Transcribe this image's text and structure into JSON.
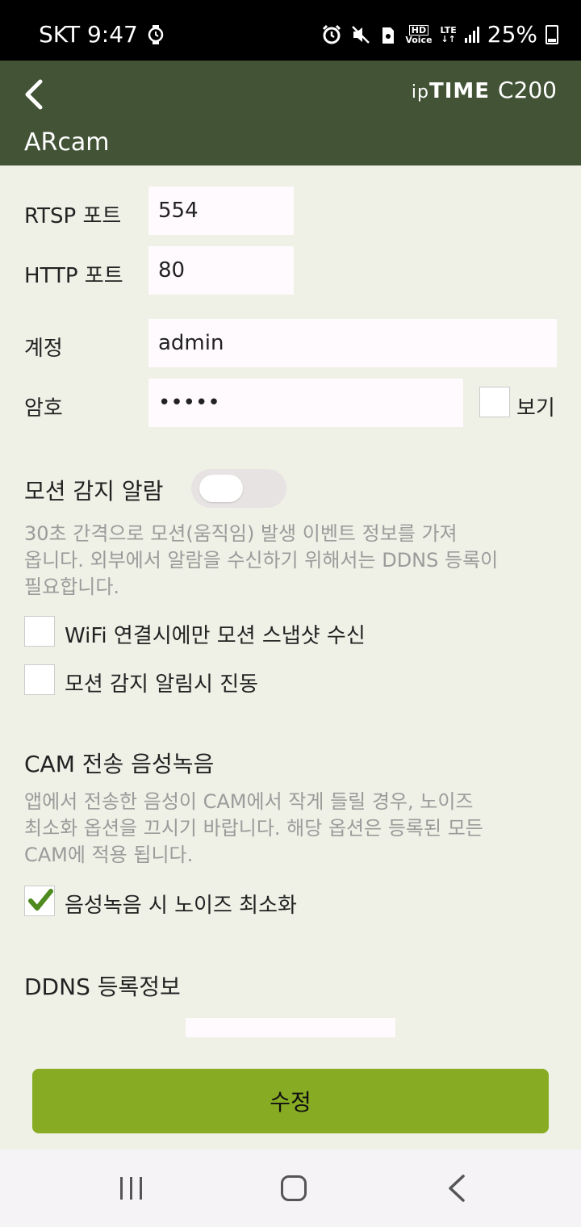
{
  "status_bar": {
    "carrier_time": "SKT 9:47",
    "battery_pct": "25%",
    "hd_voice_top": "HD",
    "hd_voice_bottom": "Voice",
    "lte": "LTE",
    "icons": [
      "watch-icon",
      "alarm-icon",
      "mute-icon",
      "storage-icon",
      "hd-voice-icon",
      "lte-icon",
      "signal-icon",
      "battery-icon"
    ]
  },
  "header": {
    "brand_ip": "ip",
    "brand_time": "TIME",
    "model": "C200",
    "camera_name": "ARcam"
  },
  "form": {
    "rtsp_label": "RTSP 포트",
    "rtsp_value": "554",
    "http_label": "HTTP 포트",
    "http_value": "80",
    "account_label": "계정",
    "account_value": "admin",
    "password_label": "암호",
    "password_value": "•••••",
    "show_label": "보기"
  },
  "motion": {
    "title": "모션 감지 알람",
    "toggle_on": false,
    "desc_line1": "30초 간격으로 모션(움직임) 발생 이벤트 정보를 가져",
    "desc_line2": "옵니다. 외부에서 알람을 수신하기 위해서는 DDNS 등록이",
    "desc_line3": "필요합니다.",
    "wifi_snapshot_label": "WiFi 연결시에만 모션 스냅샷 수신",
    "wifi_snapshot_checked": false,
    "vibrate_label": "모션 감지 알림시 진동",
    "vibrate_checked": false
  },
  "voice": {
    "title": "CAM 전송 음성녹음",
    "desc_line1": "앱에서 전송한 음성이 CAM에서 작게 들릴 경우, 노이즈",
    "desc_line2": "최소화 옵션을 끄시기 바랍니다. 해당 옵션은 등록된 모든",
    "desc_line3": "CAM에 적용 됩니다.",
    "noise_label": "음성녹음 시 노이즈 최소화",
    "noise_checked": true
  },
  "ddns": {
    "title": "DDNS 등록정보"
  },
  "actions": {
    "submit_label": "수정"
  },
  "colors": {
    "header_bg": "#425336",
    "page_bg": "#eff0e6",
    "button_bg": "#87ac23",
    "check_green": "#4e8a1e"
  }
}
